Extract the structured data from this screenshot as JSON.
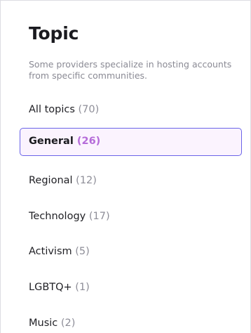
{
  "topic": {
    "title": "Topic",
    "description": "Some providers specialize in hosting accounts from specific communities.",
    "selected_index": 1,
    "items": [
      {
        "label": "All topics",
        "count": "(70)"
      },
      {
        "label": "General",
        "count": "(26)"
      },
      {
        "label": "Regional",
        "count": "(12)"
      },
      {
        "label": "Technology",
        "count": "(17)"
      },
      {
        "label": "Activism",
        "count": "(5)"
      },
      {
        "label": "LGBTQ+",
        "count": "(1)"
      },
      {
        "label": "Music",
        "count": "(2)"
      }
    ]
  },
  "colors": {
    "selected_border": "#6a64e8",
    "selected_background": "#fbf3fe",
    "selected_count": "#b56bd9",
    "muted_text": "#8a8a94"
  }
}
